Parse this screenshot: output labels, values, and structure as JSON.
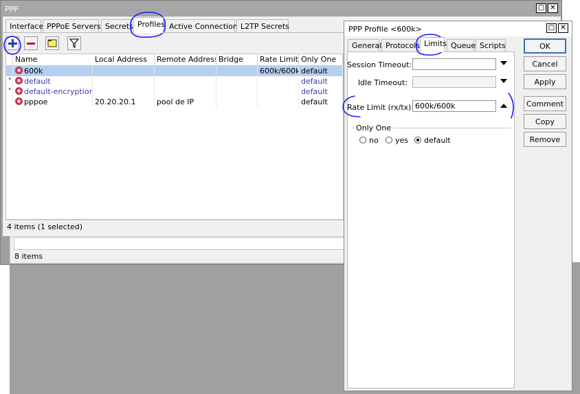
{
  "main_window": {
    "title": "PPP",
    "tabs": [
      "Interface",
      "PPPoE Servers",
      "Secrets",
      "Profiles",
      "Active Connections",
      "L2TP Secrets"
    ],
    "active_tab": "Profiles",
    "columns": [
      "Name",
      "Local Address",
      "Remote Address",
      "Bridge",
      "Rate Limit...",
      "Only One"
    ],
    "rows": [
      {
        "flag": "",
        "name": "600k",
        "local": "",
        "remote": "",
        "bridge": "",
        "rate": "600k/600k",
        "only_one": "default",
        "selected": true
      },
      {
        "flag": "*",
        "name": "default",
        "local": "",
        "remote": "",
        "bridge": "",
        "rate": "",
        "only_one": "default",
        "selected": false
      },
      {
        "flag": "*",
        "name": "default-encryption",
        "local": "",
        "remote": "",
        "bridge": "",
        "rate": "",
        "only_one": "default",
        "selected": false
      },
      {
        "flag": "",
        "name": "pppoe",
        "local": "20.20.20.1",
        "remote": "pool de IP",
        "bridge": "",
        "rate": "",
        "only_one": "default",
        "selected": false
      }
    ],
    "status": "4 items (1 selected)",
    "background_status": "8 items"
  },
  "dialog": {
    "title": "PPP Profile <600k>",
    "tabs": [
      "General",
      "Protocols",
      "Limits",
      "Queue",
      "Scripts"
    ],
    "active_tab": "Limits",
    "session_timeout_label": "Session Timeout:",
    "session_timeout_value": "",
    "idle_timeout_label": "Idle Timeout:",
    "idle_timeout_value": "",
    "rate_limit_label": "Rate Limit (rx/tx):",
    "rate_limit_value": "600k/600k",
    "only_one_label": "Only One",
    "only_one_options": [
      "no",
      "yes",
      "default"
    ],
    "only_one_selected": "default",
    "buttons": [
      "OK",
      "Cancel",
      "Apply",
      "Comment",
      "Copy",
      "Remove"
    ]
  },
  "annotation_color": "#1a1aff",
  "selection_color": "#b6cff0"
}
